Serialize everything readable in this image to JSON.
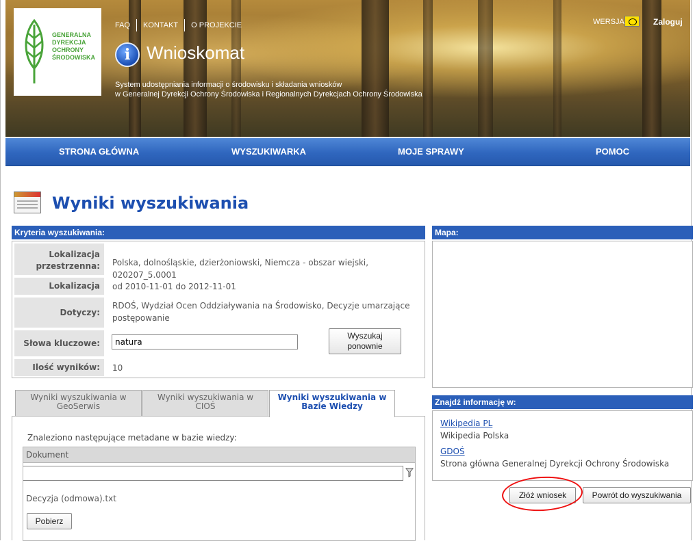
{
  "header": {
    "links": [
      "FAQ",
      "KONTAKT",
      "O PROJEKCIE"
    ],
    "logo_text": [
      "GENERALNA",
      "DYREKCJA",
      "OCHRONY",
      "ŚRODOWISKA"
    ],
    "app_title": "Wnioskomat",
    "subtitle_line1": "System udostępniania informacji o środowisku i składania wniosków",
    "subtitle_line2": "w Generalnej Dyrekcji Ochrony Środowiska i Regionalnych Dyrekcjach Ochrony Środowiska",
    "version_label": "WERSJA:",
    "login": "Zaloguj"
  },
  "nav": [
    "STRONA GŁÓWNA",
    "WYSZUKIWARKA",
    "MOJE SPRAWY",
    "POMOC"
  ],
  "page_title": "Wyniki wyszukiwania",
  "criteria": {
    "header": "Kryteria wyszukiwania:",
    "spatial_label_1": "Lokalizacja",
    "spatial_label_2": "przestrzenna:",
    "spatial_value": "Polska, dolnośląskie, dzierżoniowski, Niemcza - obszar wiejski, 020207_5.0001",
    "time_label": "Lokalizacja czasowa:",
    "time_value": "od 2010-11-01 do 2012-11-01",
    "concerns_label": "Dotyczy:",
    "concerns_value_1": "RDOŚ, Wydział Ocen Oddziaływania na Środowisko, Decyzje umarzające",
    "concerns_value_2": "postępowanie",
    "keywords_label": "Słowa kluczowe:",
    "keywords_value": "natura",
    "search_again_1": "Wyszukaj",
    "search_again_2": "ponownie",
    "results_label": "Ilość wyników:",
    "results_value": "10"
  },
  "map": {
    "header": "Mapa:"
  },
  "tabs": [
    {
      "line1": "Wyniki wyszukiwania w",
      "line2": "GeoSerwis"
    },
    {
      "line1": "Wyniki wyszukiwania w",
      "line2": "CIOŚ"
    },
    {
      "line1": "Wyniki wyszukiwania w",
      "line2": "Bazie Wiedzy"
    }
  ],
  "knowledge": {
    "found_text": "Znaleziono następujące metadane w bazie wiedzy:",
    "column_header": "Dokument",
    "filter_value": "",
    "document": "Decyzja (odmowa).txt",
    "download": "Pobierz"
  },
  "find_info": {
    "header": "Znajdź informację w:",
    "links": [
      {
        "title": "Wikipedia PL",
        "desc": "Wikipedia Polska"
      },
      {
        "title": "GDOŚ",
        "desc": "Strona główna Generalnej Dyrekcji Ochrony Środowiska"
      }
    ]
  },
  "actions": {
    "submit_request": "Złóż wniosek",
    "back_to_search": "Powrót do wyszukiwania"
  },
  "colors": {
    "accent": "#2b5fb9",
    "title": "#1d4fb0",
    "highlight": "#e11111"
  }
}
